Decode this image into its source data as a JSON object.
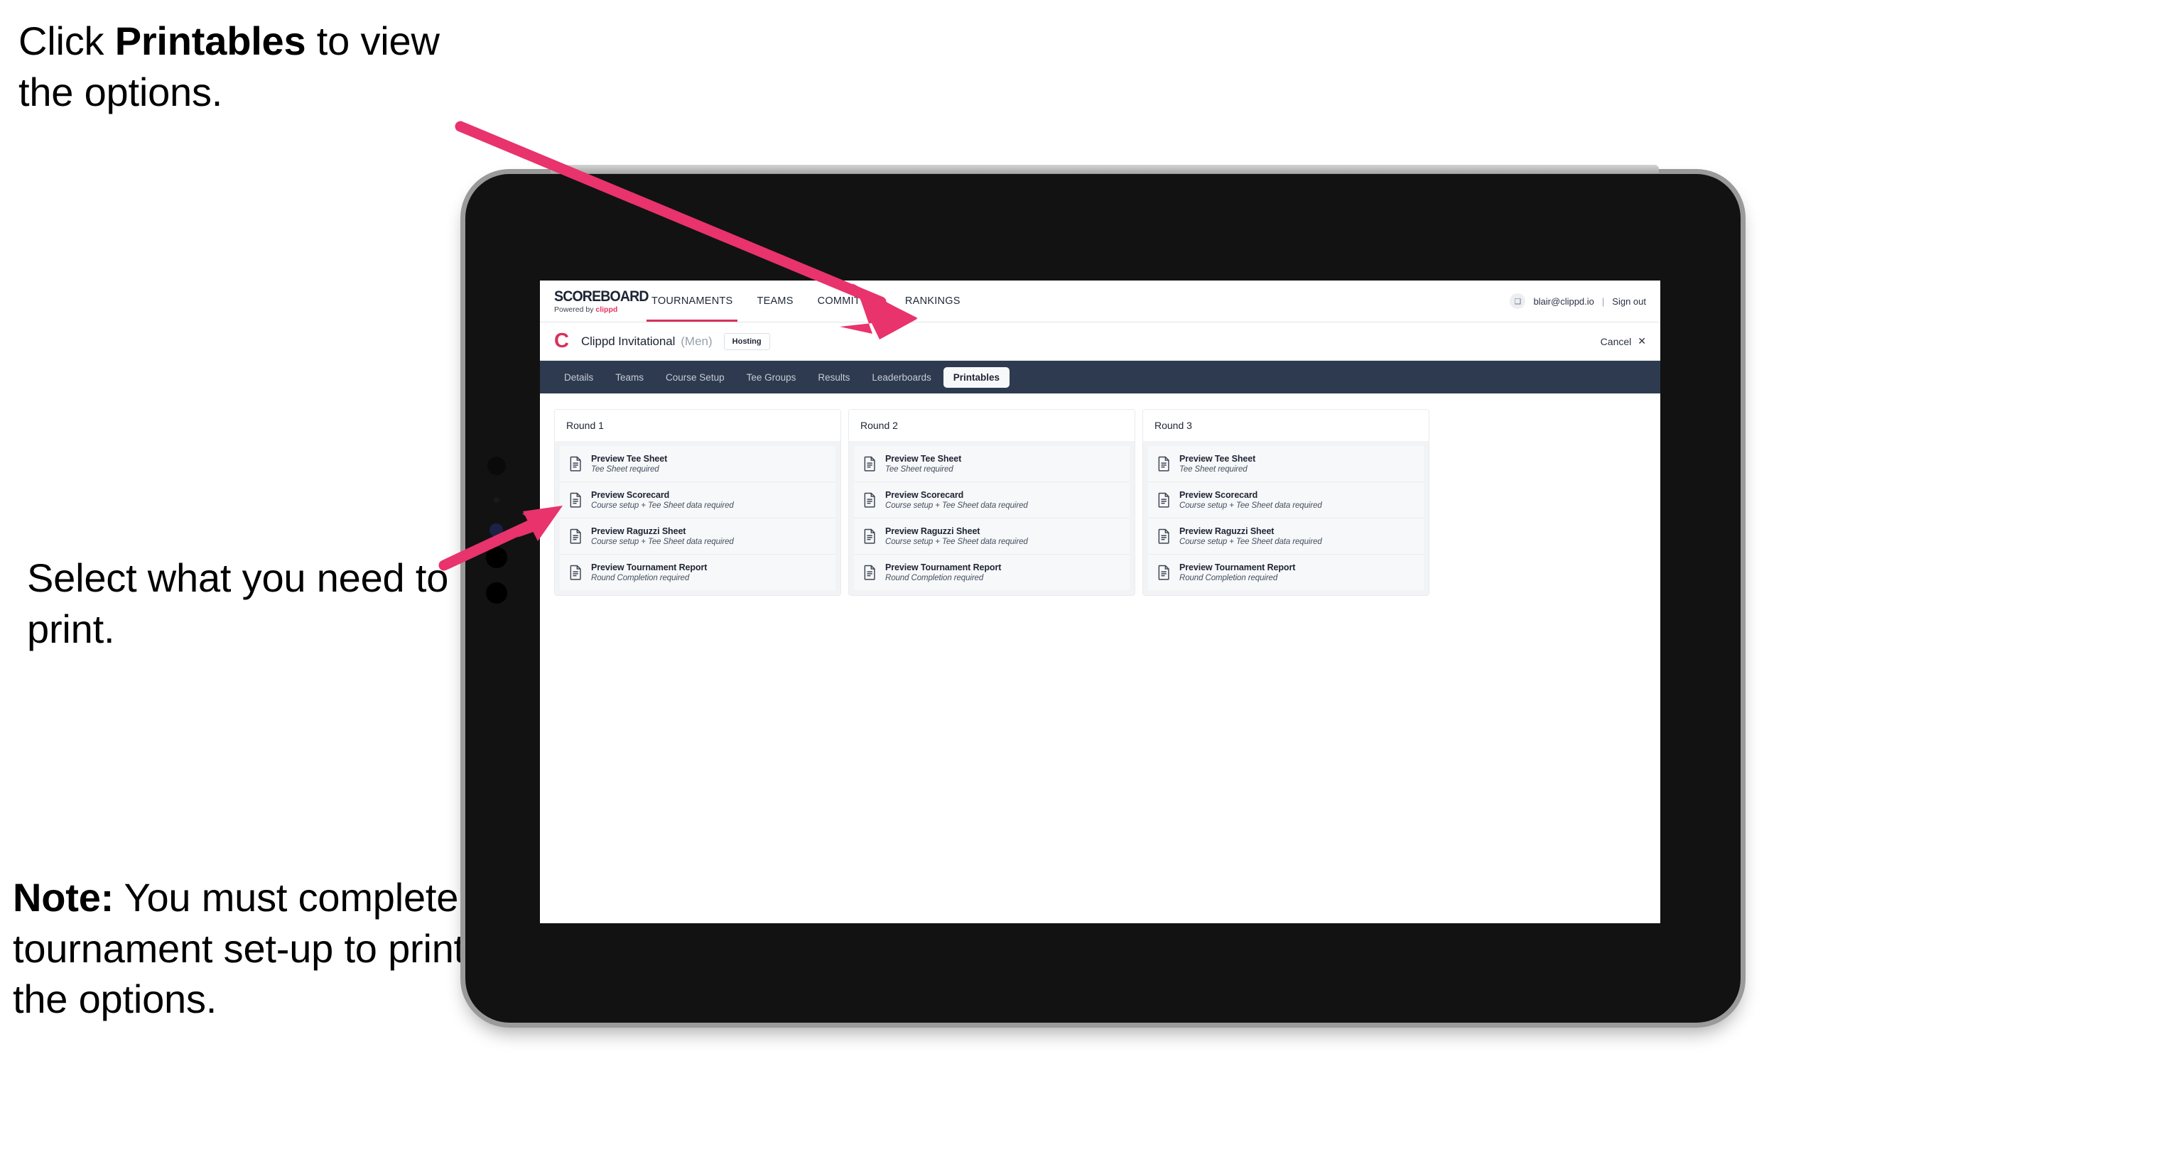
{
  "annotations": {
    "click_printables": {
      "pre": "Click ",
      "bold": "Printables",
      "post": " to view the options."
    },
    "select_print": {
      "text": "Select what you need to print."
    },
    "note": {
      "bold": "Note:",
      "text": " You must complete the tournament set-up to print all the options."
    }
  },
  "colors": {
    "arrow_pink": "#E8336D",
    "brand_red": "#D8315B",
    "tabstrip_navy": "#2E3A4F",
    "device_black": "#121212",
    "device_edge_gray": "#9A9A9A"
  },
  "app": {
    "brand": {
      "title": "SCOREBOARD",
      "powered_prefix": "Powered by ",
      "powered_name": "clippd"
    },
    "nav": [
      {
        "label": "TOURNAMENTS",
        "active": true
      },
      {
        "label": "TEAMS",
        "active": false
      },
      {
        "label": "COMMITTEE",
        "active": false
      },
      {
        "label": "RANKINGS",
        "active": false
      }
    ],
    "account": {
      "avatar_glyph": "❑",
      "email": "blair@clippd.io",
      "separator": "|",
      "sign_out": "Sign out"
    },
    "tournament": {
      "logo_letter": "C",
      "name": "Clippd Invitational",
      "gender": "(Men)",
      "badge": "Hosting",
      "cancel_label": "Cancel",
      "cancel_glyph": "✕"
    },
    "tabs": [
      {
        "label": "Details",
        "active": false
      },
      {
        "label": "Teams",
        "active": false
      },
      {
        "label": "Course Setup",
        "active": false
      },
      {
        "label": "Tee Groups",
        "active": false
      },
      {
        "label": "Results",
        "active": false
      },
      {
        "label": "Leaderboards",
        "active": false
      },
      {
        "label": "Printables",
        "active": true
      }
    ],
    "rounds": [
      {
        "title": "Round 1",
        "items": [
          {
            "title": "Preview Tee Sheet",
            "subtitle": "Tee Sheet required"
          },
          {
            "title": "Preview Scorecard",
            "subtitle": "Course setup + Tee Sheet data required"
          },
          {
            "title": "Preview Raguzzi Sheet",
            "subtitle": "Course setup + Tee Sheet data required"
          },
          {
            "title": "Preview Tournament Report",
            "subtitle": "Round Completion required"
          }
        ]
      },
      {
        "title": "Round 2",
        "items": [
          {
            "title": "Preview Tee Sheet",
            "subtitle": "Tee Sheet required"
          },
          {
            "title": "Preview Scorecard",
            "subtitle": "Course setup + Tee Sheet data required"
          },
          {
            "title": "Preview Raguzzi Sheet",
            "subtitle": "Course setup + Tee Sheet data required"
          },
          {
            "title": "Preview Tournament Report",
            "subtitle": "Round Completion required"
          }
        ]
      },
      {
        "title": "Round 3",
        "items": [
          {
            "title": "Preview Tee Sheet",
            "subtitle": "Tee Sheet required"
          },
          {
            "title": "Preview Scorecard",
            "subtitle": "Course setup + Tee Sheet data required"
          },
          {
            "title": "Preview Raguzzi Sheet",
            "subtitle": "Course setup + Tee Sheet data required"
          },
          {
            "title": "Preview Tournament Report",
            "subtitle": "Round Completion required"
          }
        ]
      }
    ]
  }
}
